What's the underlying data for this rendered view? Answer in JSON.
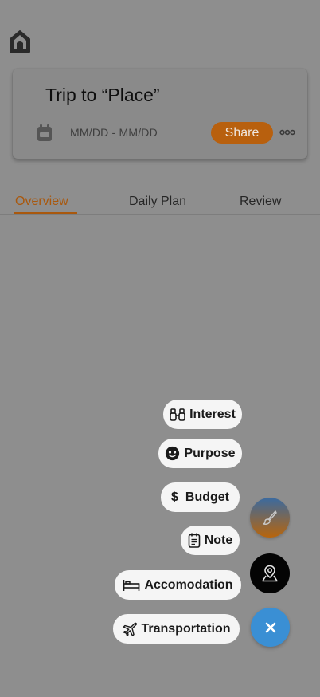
{
  "header": {
    "home_icon": "home-icon"
  },
  "trip": {
    "title": "Trip to “Place”",
    "date_range": "MM/DD - MM/DD",
    "share_label": "Share",
    "calendar_icon": "calendar-icon",
    "more_icon": "more-horizontal-icon"
  },
  "tabs": [
    {
      "label": "Overview",
      "active": true
    },
    {
      "label": "Daily Plan",
      "active": false
    },
    {
      "label": "Review",
      "active": false
    }
  ],
  "speed_dial": {
    "items": [
      {
        "label": "Interest",
        "icon": "binoculars-icon"
      },
      {
        "label": "Purpose",
        "icon": "smiley-icon"
      },
      {
        "label": "Budget",
        "icon": "dollar-icon"
      },
      {
        "label": "Note",
        "icon": "notepad-icon"
      },
      {
        "label": "Accomodation",
        "icon": "bed-icon"
      },
      {
        "label": "Transportation",
        "icon": "airplane-icon"
      }
    ],
    "edit_icon": "brush-icon",
    "map_icon": "map-pin-icon",
    "close_icon": "close-icon"
  },
  "colors": {
    "overlay_bg": "#8e8e8e",
    "accent_orange": "#b8600e",
    "active_tab": "#a9580d",
    "fab_blue": "#3a8fd4",
    "fab_black": "#040404"
  }
}
